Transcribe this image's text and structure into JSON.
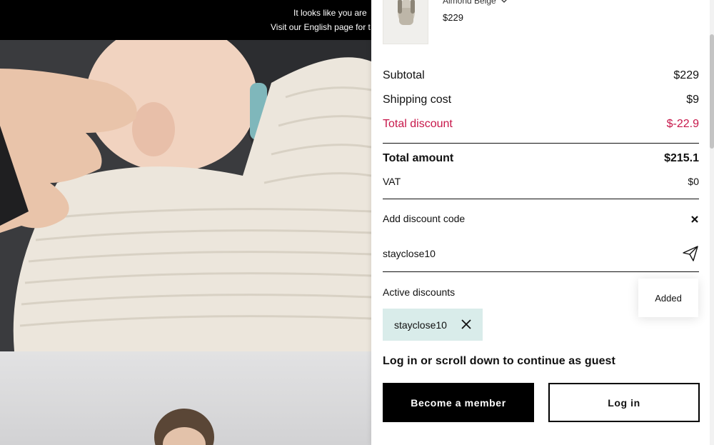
{
  "banner": {
    "line1": "It looks like you are",
    "line2": "Visit our English page for t"
  },
  "cart": {
    "product": {
      "variant": "Almond Beige",
      "price": "$229",
      "image_icon": "baby-carrier-product-image"
    },
    "summary": {
      "subtotal_label": "Subtotal",
      "subtotal_value": "$229",
      "shipping_label": "Shipping cost",
      "shipping_value": "$9",
      "discount_label": "Total discount",
      "discount_value": "$-22.9",
      "total_label": "Total amount",
      "total_value": "$215.1",
      "vat_label": "VAT",
      "vat_value": "$0"
    },
    "discount_code": {
      "label": "Add discount code",
      "value": "stayclose10",
      "send_icon": "paper-plane-icon",
      "close_icon": "close-icon"
    },
    "active_discounts": {
      "label": "Active discounts",
      "toast": "Added",
      "chips": [
        "stayclose10"
      ]
    },
    "guest_message": "Log in or scroll down to continue as guest",
    "buttons": {
      "member": "Become a member",
      "login": "Log in"
    }
  },
  "colors": {
    "discount": "#c7174a",
    "chip_bg": "#d9ecea",
    "button_primary": "#000000"
  }
}
